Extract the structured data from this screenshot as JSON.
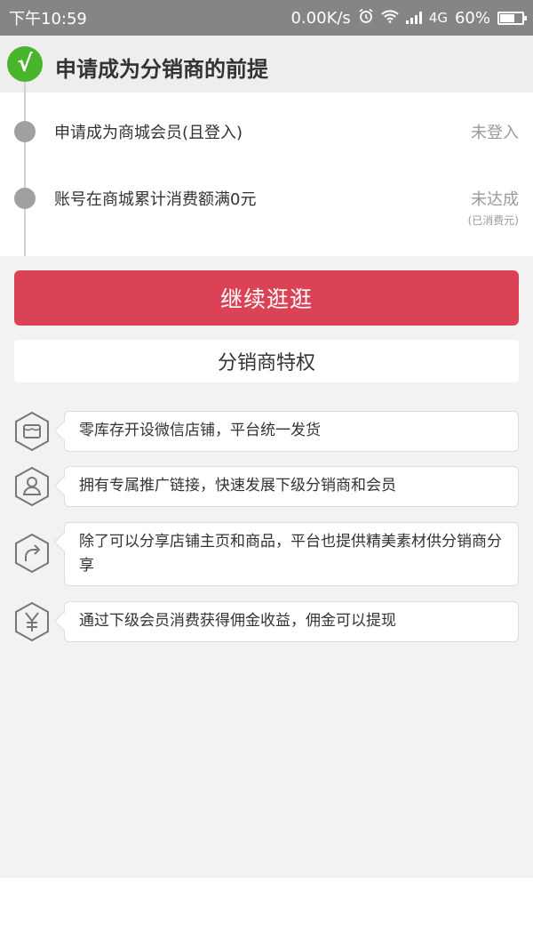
{
  "status_bar": {
    "time": "下午10:59",
    "net_speed": "0.00K/s",
    "network": "4G",
    "battery": "60%",
    "battery_level": 0.6
  },
  "header": {
    "check_glyph": "√",
    "title": "申请成为分销商的前提"
  },
  "requirements": [
    {
      "text": "申请成为商城会员(且登入)",
      "status": "未登入",
      "sub": ""
    },
    {
      "text": "账号在商城累计消费额满0元",
      "status": "未达成",
      "sub": "(已消费元)"
    }
  ],
  "continue_button": {
    "label": "继续逛逛"
  },
  "privileges": {
    "title": "分销商特权",
    "items": [
      {
        "icon": "store-icon",
        "text": "零库存开设微信店铺，平台统一发货"
      },
      {
        "icon": "user-icon",
        "text": "拥有专属推广链接，快速发展下级分销商和会员"
      },
      {
        "icon": "share-icon",
        "text": "除了可以分享店铺主页和商品，平台也提供精美素材供分销商分享"
      },
      {
        "icon": "yen-icon",
        "text": "通过下级会员消费获得佣金收益，佣金可以提现"
      }
    ]
  },
  "colors": {
    "accent_red": "#dc4255",
    "success_green": "#49b52c",
    "status_gray": "#9a9a9a"
  }
}
